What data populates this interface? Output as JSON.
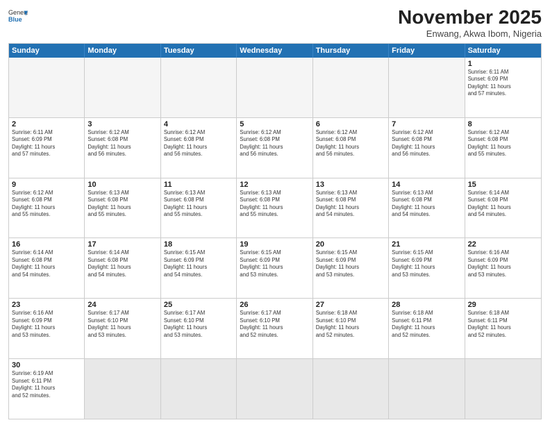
{
  "header": {
    "logo_general": "General",
    "logo_blue": "Blue",
    "month_title": "November 2025",
    "location": "Enwang, Akwa Ibom, Nigeria"
  },
  "days_of_week": [
    "Sunday",
    "Monday",
    "Tuesday",
    "Wednesday",
    "Thursday",
    "Friday",
    "Saturday"
  ],
  "weeks": [
    [
      {
        "day": "",
        "info": ""
      },
      {
        "day": "",
        "info": ""
      },
      {
        "day": "",
        "info": ""
      },
      {
        "day": "",
        "info": ""
      },
      {
        "day": "",
        "info": ""
      },
      {
        "day": "",
        "info": ""
      },
      {
        "day": "1",
        "info": "Sunrise: 6:11 AM\nSunset: 6:09 PM\nDaylight: 11 hours\nand 57 minutes."
      }
    ],
    [
      {
        "day": "2",
        "info": "Sunrise: 6:11 AM\nSunset: 6:09 PM\nDaylight: 11 hours\nand 57 minutes."
      },
      {
        "day": "3",
        "info": "Sunrise: 6:12 AM\nSunset: 6:08 PM\nDaylight: 11 hours\nand 56 minutes."
      },
      {
        "day": "4",
        "info": "Sunrise: 6:12 AM\nSunset: 6:08 PM\nDaylight: 11 hours\nand 56 minutes."
      },
      {
        "day": "5",
        "info": "Sunrise: 6:12 AM\nSunset: 6:08 PM\nDaylight: 11 hours\nand 56 minutes."
      },
      {
        "day": "6",
        "info": "Sunrise: 6:12 AM\nSunset: 6:08 PM\nDaylight: 11 hours\nand 56 minutes."
      },
      {
        "day": "7",
        "info": "Sunrise: 6:12 AM\nSunset: 6:08 PM\nDaylight: 11 hours\nand 56 minutes."
      },
      {
        "day": "8",
        "info": "Sunrise: 6:12 AM\nSunset: 6:08 PM\nDaylight: 11 hours\nand 55 minutes."
      }
    ],
    [
      {
        "day": "9",
        "info": "Sunrise: 6:12 AM\nSunset: 6:08 PM\nDaylight: 11 hours\nand 55 minutes."
      },
      {
        "day": "10",
        "info": "Sunrise: 6:13 AM\nSunset: 6:08 PM\nDaylight: 11 hours\nand 55 minutes."
      },
      {
        "day": "11",
        "info": "Sunrise: 6:13 AM\nSunset: 6:08 PM\nDaylight: 11 hours\nand 55 minutes."
      },
      {
        "day": "12",
        "info": "Sunrise: 6:13 AM\nSunset: 6:08 PM\nDaylight: 11 hours\nand 55 minutes."
      },
      {
        "day": "13",
        "info": "Sunrise: 6:13 AM\nSunset: 6:08 PM\nDaylight: 11 hours\nand 54 minutes."
      },
      {
        "day": "14",
        "info": "Sunrise: 6:13 AM\nSunset: 6:08 PM\nDaylight: 11 hours\nand 54 minutes."
      },
      {
        "day": "15",
        "info": "Sunrise: 6:14 AM\nSunset: 6:08 PM\nDaylight: 11 hours\nand 54 minutes."
      }
    ],
    [
      {
        "day": "16",
        "info": "Sunrise: 6:14 AM\nSunset: 6:08 PM\nDaylight: 11 hours\nand 54 minutes."
      },
      {
        "day": "17",
        "info": "Sunrise: 6:14 AM\nSunset: 6:08 PM\nDaylight: 11 hours\nand 54 minutes."
      },
      {
        "day": "18",
        "info": "Sunrise: 6:15 AM\nSunset: 6:09 PM\nDaylight: 11 hours\nand 54 minutes."
      },
      {
        "day": "19",
        "info": "Sunrise: 6:15 AM\nSunset: 6:09 PM\nDaylight: 11 hours\nand 53 minutes."
      },
      {
        "day": "20",
        "info": "Sunrise: 6:15 AM\nSunset: 6:09 PM\nDaylight: 11 hours\nand 53 minutes."
      },
      {
        "day": "21",
        "info": "Sunrise: 6:15 AM\nSunset: 6:09 PM\nDaylight: 11 hours\nand 53 minutes."
      },
      {
        "day": "22",
        "info": "Sunrise: 6:16 AM\nSunset: 6:09 PM\nDaylight: 11 hours\nand 53 minutes."
      }
    ],
    [
      {
        "day": "23",
        "info": "Sunrise: 6:16 AM\nSunset: 6:09 PM\nDaylight: 11 hours\nand 53 minutes."
      },
      {
        "day": "24",
        "info": "Sunrise: 6:17 AM\nSunset: 6:10 PM\nDaylight: 11 hours\nand 53 minutes."
      },
      {
        "day": "25",
        "info": "Sunrise: 6:17 AM\nSunset: 6:10 PM\nDaylight: 11 hours\nand 53 minutes."
      },
      {
        "day": "26",
        "info": "Sunrise: 6:17 AM\nSunset: 6:10 PM\nDaylight: 11 hours\nand 52 minutes."
      },
      {
        "day": "27",
        "info": "Sunrise: 6:18 AM\nSunset: 6:10 PM\nDaylight: 11 hours\nand 52 minutes."
      },
      {
        "day": "28",
        "info": "Sunrise: 6:18 AM\nSunset: 6:11 PM\nDaylight: 11 hours\nand 52 minutes."
      },
      {
        "day": "29",
        "info": "Sunrise: 6:18 AM\nSunset: 6:11 PM\nDaylight: 11 hours\nand 52 minutes."
      }
    ],
    [
      {
        "day": "30",
        "info": "Sunrise: 6:19 AM\nSunset: 6:11 PM\nDaylight: 11 hours\nand 52 minutes."
      },
      {
        "day": "",
        "info": ""
      },
      {
        "day": "",
        "info": ""
      },
      {
        "day": "",
        "info": ""
      },
      {
        "day": "",
        "info": ""
      },
      {
        "day": "",
        "info": ""
      },
      {
        "day": "",
        "info": ""
      }
    ]
  ]
}
